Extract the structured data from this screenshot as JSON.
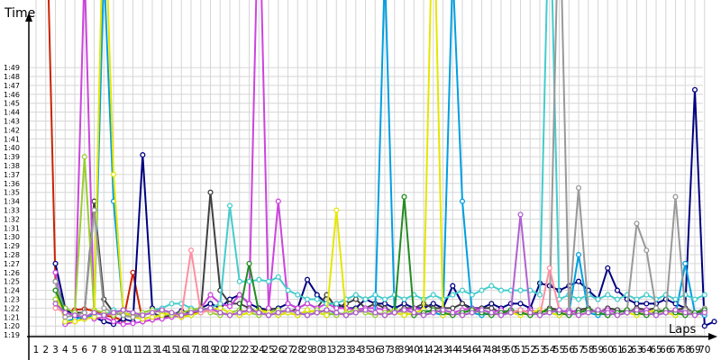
{
  "chart_data": {
    "type": "line",
    "title": "",
    "xlabel": "Laps",
    "ylabel": "Time",
    "x_range": [
      1,
      70
    ],
    "y_range_seconds": [
      78,
      109
    ],
    "y_ticks": [
      "1:19",
      "1:20",
      "1:21",
      "1:22",
      "1:23",
      "1:24",
      "1:25",
      "1:26",
      "1:27",
      "1:28",
      "1:29",
      "1:30",
      "1:31",
      "1:32",
      "1:33",
      "1:34",
      "1:35",
      "1:36",
      "1:37",
      "1:38",
      "1:39",
      "1:40",
      "1:41",
      "1:42",
      "1:43",
      "1:44",
      "1:45",
      "1:46",
      "1:47",
      "1:48",
      "1:49"
    ],
    "x_ticks": [
      "1",
      "2",
      "3",
      "4",
      "5",
      "6",
      "7",
      "8",
      "9",
      "10",
      "11",
      "12",
      "13",
      "14",
      "15",
      "16",
      "17",
      "18",
      "19",
      "20",
      "21",
      "22",
      "23",
      "24",
      "25",
      "26",
      "27",
      "28",
      "29",
      "30",
      "31",
      "32",
      "33",
      "34",
      "35",
      "36",
      "37",
      "38",
      "39",
      "40",
      "41",
      "42",
      "43",
      "44",
      "45",
      "46",
      "47",
      "48",
      "49",
      "50",
      "51",
      "52",
      "53",
      "54",
      "55",
      "56",
      "57",
      "58",
      "59",
      "60",
      "61",
      "62",
      "63",
      "64",
      "65",
      "66",
      "67",
      "68",
      "69",
      "70"
    ],
    "grid": true,
    "legend": "none",
    "series": [
      {
        "color": "#cc2200",
        "start": 2,
        "values": [
          130,
          85.0,
          81.6,
          81.8,
          81.9,
          81.7,
          81.2,
          81.0,
          80.6,
          86.0,
          80.5,
          80.7,
          80.9,
          81.2,
          81.0,
          81.4,
          81.6
        ]
      },
      {
        "color": "#000080",
        "start": 3,
        "values": [
          87,
          82,
          81,
          80.8,
          81,
          80.5,
          80.2,
          80.8,
          80.5,
          99.2,
          82,
          81.5,
          81.2,
          81.7,
          81.5,
          82,
          82.5,
          82,
          83,
          83.5,
          82.5,
          82,
          81.8,
          82,
          82.5,
          82,
          85.2,
          83.5,
          82.5,
          82.5,
          82,
          82,
          83,
          82.5,
          82.5,
          82,
          82.5,
          82,
          82,
          82.5,
          82,
          84.5,
          82.5,
          82,
          82,
          82.5,
          82,
          82.5,
          82.5,
          82,
          84.8,
          84.5,
          84,
          84.5,
          85,
          84,
          83,
          86.5,
          84,
          83,
          82.5,
          82.5,
          82.5,
          83,
          82.5,
          82,
          106.5,
          80,
          80.5
        ]
      },
      {
        "color": "#404040",
        "start": 3,
        "values": [
          85,
          82,
          81.5,
          81.5,
          94,
          83,
          81.5,
          81.2,
          81,
          81.2,
          81.5,
          81,
          81.2,
          81.5,
          81.8,
          81.5,
          95,
          84,
          82.5,
          82.5,
          82,
          81.5,
          82,
          81.8,
          81.5,
          82,
          82.5,
          82,
          83.5,
          82,
          82.5,
          83,
          82,
          82.5,
          82,
          81.5,
          82,
          82,
          82.5,
          82,
          82,
          82,
          82.5,
          81.8,
          82,
          82,
          81.5,
          81.5,
          81.8,
          81.5,
          81.5,
          82,
          81.8,
          81.5,
          81.8,
          82,
          81.5,
          82,
          81.8,
          81.5,
          82,
          81.8,
          82,
          81.5,
          81.8,
          82,
          81.5,
          81.5
        ]
      },
      {
        "color": "#cc44dd",
        "start": 3,
        "values": [
          86,
          80.2,
          80.5,
          120,
          80.8,
          81,
          80.5,
          80.2,
          80.3,
          80.5,
          80.7,
          80.8,
          81,
          81.2,
          81.5,
          82,
          83.5,
          82.5,
          82.2,
          83.5,
          82.5,
          130,
          82,
          94,
          82.5,
          82,
          82.5,
          82,
          82.5,
          82,
          82,
          81.8,
          82,
          82,
          81.8,
          81.5,
          81.8,
          82,
          81.8,
          81.5,
          81.8,
          81.5,
          81.8,
          82,
          81.8,
          81.5,
          81.8,
          81.5,
          81.5,
          81.8,
          81.5,
          81.8,
          81.5,
          81.8,
          81.5,
          81.8,
          81.5,
          81.8,
          81.5,
          81.8,
          81.5,
          81.8,
          81.5,
          81.8,
          81.5,
          81.8,
          81.5,
          81.8
        ]
      },
      {
        "color": "#009fe0",
        "start": 3,
        "values": [
          84,
          80.5,
          80.8,
          81,
          81.2,
          120,
          94,
          81.5,
          81,
          80.8,
          81,
          81.2,
          81.5,
          81,
          81.2,
          81.5,
          81.8,
          82,
          81.5,
          81.2,
          81.5,
          81.8,
          81.5,
          81.2,
          81.5,
          81.2,
          81.8,
          81.5,
          81.2,
          81.5,
          81.2,
          81.5,
          81.8,
          81.5,
          120,
          81.5,
          81.2,
          81.5,
          81.8,
          81.5,
          81.2,
          120,
          94,
          81.5,
          81.2,
          81.5,
          81.2,
          81.5,
          81.8,
          81.5,
          81.2,
          81.5,
          81.2,
          81.5,
          88,
          81.5,
          81.2,
          81.5,
          81.2,
          81.5,
          81.8,
          81.5,
          81.2,
          81.5,
          81.2,
          87,
          81.5,
          81.2
        ]
      },
      {
        "color": "#44cccc",
        "start": 3,
        "values": [
          85,
          81.5,
          81.2,
          81,
          81.5,
          81.2,
          81.8,
          81.5,
          81.2,
          81.5,
          81.8,
          82,
          82.5,
          82.5,
          82,
          81.8,
          82,
          82.5,
          93.5,
          85,
          85,
          85.2,
          85,
          85.5,
          84,
          83.5,
          83,
          83,
          82.5,
          82.5,
          83,
          83.5,
          83,
          83.5,
          83,
          83.5,
          83,
          83.5,
          83,
          83.5,
          83,
          83.5,
          84,
          83.5,
          84,
          84.5,
          84,
          84,
          84,
          84,
          83.5,
          130,
          83,
          83.5,
          83,
          83.5,
          83,
          83.5,
          83,
          83.5,
          83,
          83.5,
          83,
          83.5,
          83,
          83.5,
          83,
          83.5
        ]
      },
      {
        "color": "#9acd32",
        "start": 3,
        "values": [
          83,
          82,
          81.5,
          99,
          81.8,
          81.5,
          81.2,
          81.5,
          81.2,
          81.5,
          81.8,
          81.5,
          81.2,
          81.5,
          81.8,
          82,
          81.5,
          81.2,
          81.5,
          81.8,
          81.5,
          81.2,
          81.5,
          81.8,
          81.5,
          81.2,
          81.5,
          81.8,
          81.5,
          81.2,
          81.5,
          81.8,
          81.5,
          81.2,
          81.5,
          81.8,
          81.5,
          81.2,
          81.5,
          81.8,
          81.5,
          81.2,
          81.5,
          81.8,
          81.5,
          81.2,
          81.5,
          81.8,
          81.5,
          81.2,
          81.5,
          81.8,
          81.5,
          81.2,
          81.5,
          81.8,
          81.5,
          81.2,
          81.5,
          81.8,
          81.5,
          81.2,
          81.5,
          81.8,
          81.5,
          81.2,
          81.5,
          81.8
        ]
      },
      {
        "color": "#e6e600",
        "start": 3,
        "values": [
          84,
          80.5,
          80.5,
          80.8,
          81,
          130,
          97,
          81.5,
          81,
          80.8,
          81,
          81.2,
          81.5,
          81,
          81.2,
          81.5,
          81.8,
          82,
          81.5,
          81.2,
          81.5,
          81.8,
          81.5,
          81.2,
          81.5,
          81.2,
          81.8,
          81.5,
          81.2,
          93,
          81.2,
          81.5,
          81.8,
          81.5,
          81.2,
          81.5,
          81.2,
          81.5,
          81.8,
          130,
          81.2,
          81.5,
          81.2,
          81.5,
          81.8,
          81.5,
          81.2,
          81.5,
          81.2,
          81.5,
          81.8,
          81.5,
          81.2,
          81.5,
          81.2,
          81.5,
          81.8,
          81.5,
          81.2,
          81.5,
          81.2,
          81.5,
          81.8,
          81.5,
          81.2,
          81.5,
          81.2,
          81.5
        ]
      },
      {
        "color": "#999999",
        "start": 3,
        "values": [
          85,
          81,
          81.2,
          81.5,
          93,
          82,
          81.5,
          81.2,
          81,
          81.2,
          81.5,
          81.8,
          81.5,
          81.2,
          81.5,
          81.8,
          82,
          81.5,
          81.2,
          81.5,
          81.8,
          81.5,
          81.2,
          81.5,
          81.8,
          81.5,
          81.2,
          81.5,
          81.8,
          81.5,
          81.2,
          81.5,
          81.8,
          81.5,
          81.2,
          81.5,
          81.8,
          81.5,
          81.2,
          81.5,
          81.8,
          81.5,
          81.2,
          81.5,
          81.8,
          81.5,
          81.2,
          81.5,
          81.8,
          81.5,
          81.2,
          81.5,
          130,
          81.5,
          95.5,
          81.8,
          81.5,
          81.2,
          81.5,
          81.8,
          91.5,
          88.5,
          82,
          81.5,
          94.5,
          81.8,
          81.5,
          82
        ]
      },
      {
        "color": "#228b22",
        "start": 3,
        "values": [
          84,
          81.5,
          81.2,
          81,
          81.5,
          81.2,
          81.5,
          81.8,
          81.5,
          81.2,
          81.5,
          81.8,
          81.5,
          81.2,
          81.5,
          81.8,
          82,
          81.5,
          81.2,
          81.5,
          87,
          81.5,
          81.2,
          81.5,
          81.8,
          81.5,
          81.2,
          81.5,
          81.8,
          81.5,
          81.2,
          81.5,
          81.8,
          81.5,
          81.2,
          81.5,
          94.5,
          81.2,
          81.5,
          81.8,
          81.5,
          81.2,
          81.5,
          81.8,
          81.5,
          81.2,
          81.5,
          81.8,
          81.5,
          81.2,
          81.5,
          81.8,
          81.5,
          81.2,
          81.5,
          81.8,
          81.5,
          81.2,
          81.5,
          81.8,
          81.5,
          81.2,
          81.5,
          81.8,
          81.5,
          81.2,
          81.5,
          81.8
        ]
      },
      {
        "color": "#ff8fa0",
        "start": 3,
        "values": [
          82,
          81.5,
          81.2,
          81,
          81.5,
          81.2,
          81.5,
          81.8,
          81.5,
          81.2,
          81.5,
          81.8,
          81.5,
          81.2,
          88.5,
          81.5,
          81.8,
          81.5,
          81.2,
          81.5,
          81.8,
          81.5,
          81.2,
          81.5,
          81.8,
          81.5,
          81.2,
          81.5,
          81.8,
          81.5,
          81.2,
          81.5,
          81.8,
          81.5,
          81.2,
          81.5,
          81.8,
          81.5,
          81.2,
          81.5,
          81.8,
          81.5,
          81.2,
          81.5,
          81.8,
          81.5,
          81.2,
          81.5,
          81.8,
          81.5,
          81.2,
          86.5,
          81.8,
          81.5,
          81.2,
          81.5,
          81.8,
          81.5,
          81.2,
          81.5,
          81.8,
          81.5,
          81.2,
          81.5,
          81.8,
          81.5,
          81.2,
          81.5
        ]
      },
      {
        "color": "#b060d0",
        "start": 3,
        "values": [
          82.5,
          81.5,
          81.2,
          81,
          81.5,
          81.2,
          81.5,
          81.8,
          81.5,
          81.2,
          81.5,
          81.8,
          81.5,
          81.2,
          81.5,
          81.8,
          82,
          81.5,
          81.2,
          81.5,
          81.8,
          81.5,
          81.2,
          81.5,
          81.8,
          81.5,
          81.2,
          81.5,
          81.8,
          81.5,
          81.2,
          81.5,
          81.8,
          81.5,
          81.2,
          81.5,
          81.8,
          81.5,
          81.2,
          81.5,
          81.8,
          81.5,
          81.2,
          81.5,
          81.8,
          81.5,
          81.2,
          81.5,
          92.5,
          81.5,
          81.2,
          81.5,
          81.8,
          81.5,
          81.2,
          81.5,
          81.8,
          81.5,
          81.2,
          81.5,
          81.8,
          81.5,
          81.2,
          81.5,
          81.8,
          81.5,
          81.2,
          81.5
        ]
      }
    ]
  }
}
